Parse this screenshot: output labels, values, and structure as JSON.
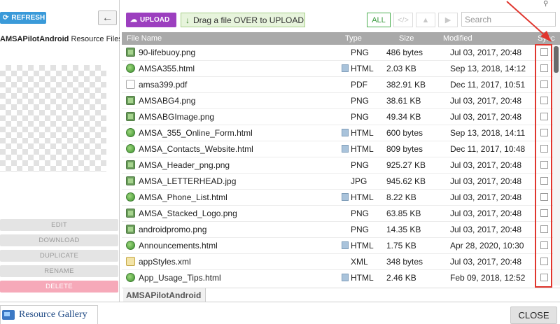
{
  "left_panel": {
    "refresh_label": "REFRESH",
    "title_bold": "AMSAPilotAndroid",
    "title_rest": " Resource Files",
    "actions": {
      "edit": "EDIT",
      "download": "DOWNLOAD",
      "duplicate": "DUPLICATE",
      "rename": "RENAME",
      "delete": "DELETE"
    }
  },
  "toolbar": {
    "upload_label": "UPLOAD",
    "drop_label": "Drag a file OVER to UPLOAD",
    "filter_all": "ALL",
    "filter_code": "</>",
    "filter_image": "▲",
    "filter_video": "▶",
    "search_placeholder": "Search"
  },
  "table": {
    "columns": {
      "name": "File Name",
      "type": "Type",
      "size": "Size",
      "modified": "Modified",
      "sync": "Sync"
    },
    "rows": [
      {
        "name": "90-lifebuoy.png",
        "type": "PNG",
        "size": "486 bytes",
        "modified": "Jul 03, 2017, 20:48",
        "icon": "img"
      },
      {
        "name": "AMSA355.html",
        "type": "HTML",
        "size": "2.03 KB",
        "modified": "Sep 13, 2018, 14:12",
        "icon": "html"
      },
      {
        "name": "amsa399.pdf",
        "type": "PDF",
        "size": "382.91 KB",
        "modified": "Dec 11, 2017, 10:51",
        "icon": "pdf"
      },
      {
        "name": "AMSABG4.png",
        "type": "PNG",
        "size": "38.61 KB",
        "modified": "Jul 03, 2017, 20:48",
        "icon": "img"
      },
      {
        "name": "AMSABGImage.png",
        "type": "PNG",
        "size": "49.34 KB",
        "modified": "Jul 03, 2017, 20:48",
        "icon": "img"
      },
      {
        "name": "AMSA_355_Online_Form.html",
        "type": "HTML",
        "size": "600 bytes",
        "modified": "Sep 13, 2018, 14:11",
        "icon": "html"
      },
      {
        "name": "AMSA_Contacts_Website.html",
        "type": "HTML",
        "size": "809 bytes",
        "modified": "Dec 11, 2017, 10:48",
        "icon": "html"
      },
      {
        "name": "AMSA_Header_png.png",
        "type": "PNG",
        "size": "925.27 KB",
        "modified": "Jul 03, 2017, 20:48",
        "icon": "img"
      },
      {
        "name": "AMSA_LETTERHEAD.jpg",
        "type": "JPG",
        "size": "945.62 KB",
        "modified": "Jul 03, 2017, 20:48",
        "icon": "img"
      },
      {
        "name": "AMSA_Phone_List.html",
        "type": "HTML",
        "size": "8.22 KB",
        "modified": "Jul 03, 2017, 20:48",
        "icon": "html"
      },
      {
        "name": "AMSA_Stacked_Logo.png",
        "type": "PNG",
        "size": "63.85 KB",
        "modified": "Jul 03, 2017, 20:48",
        "icon": "img"
      },
      {
        "name": "androidpromo.png",
        "type": "PNG",
        "size": "14.35 KB",
        "modified": "Jul 03, 2017, 20:48",
        "icon": "img"
      },
      {
        "name": "Announcements.html",
        "type": "HTML",
        "size": "1.75 KB",
        "modified": "Apr 28, 2020, 10:30",
        "icon": "html"
      },
      {
        "name": "appStyles.xml",
        "type": "XML",
        "size": "348 bytes",
        "modified": "Jul 03, 2017, 20:48",
        "icon": "xml"
      },
      {
        "name": "App_Usage_Tips.html",
        "type": "HTML",
        "size": "2.46 KB",
        "modified": "Feb 09, 2018, 12:52",
        "icon": "html"
      }
    ]
  },
  "breadcrumb": "AMSAPilotAndroid",
  "footer": {
    "gallery_label": "Resource Gallery",
    "close_label": "CLOSE"
  },
  "colors": {
    "highlight": "#e0362e",
    "upload": "#9c3fbf",
    "refresh": "#3a9ad9",
    "delete": "#f6a9b9"
  }
}
